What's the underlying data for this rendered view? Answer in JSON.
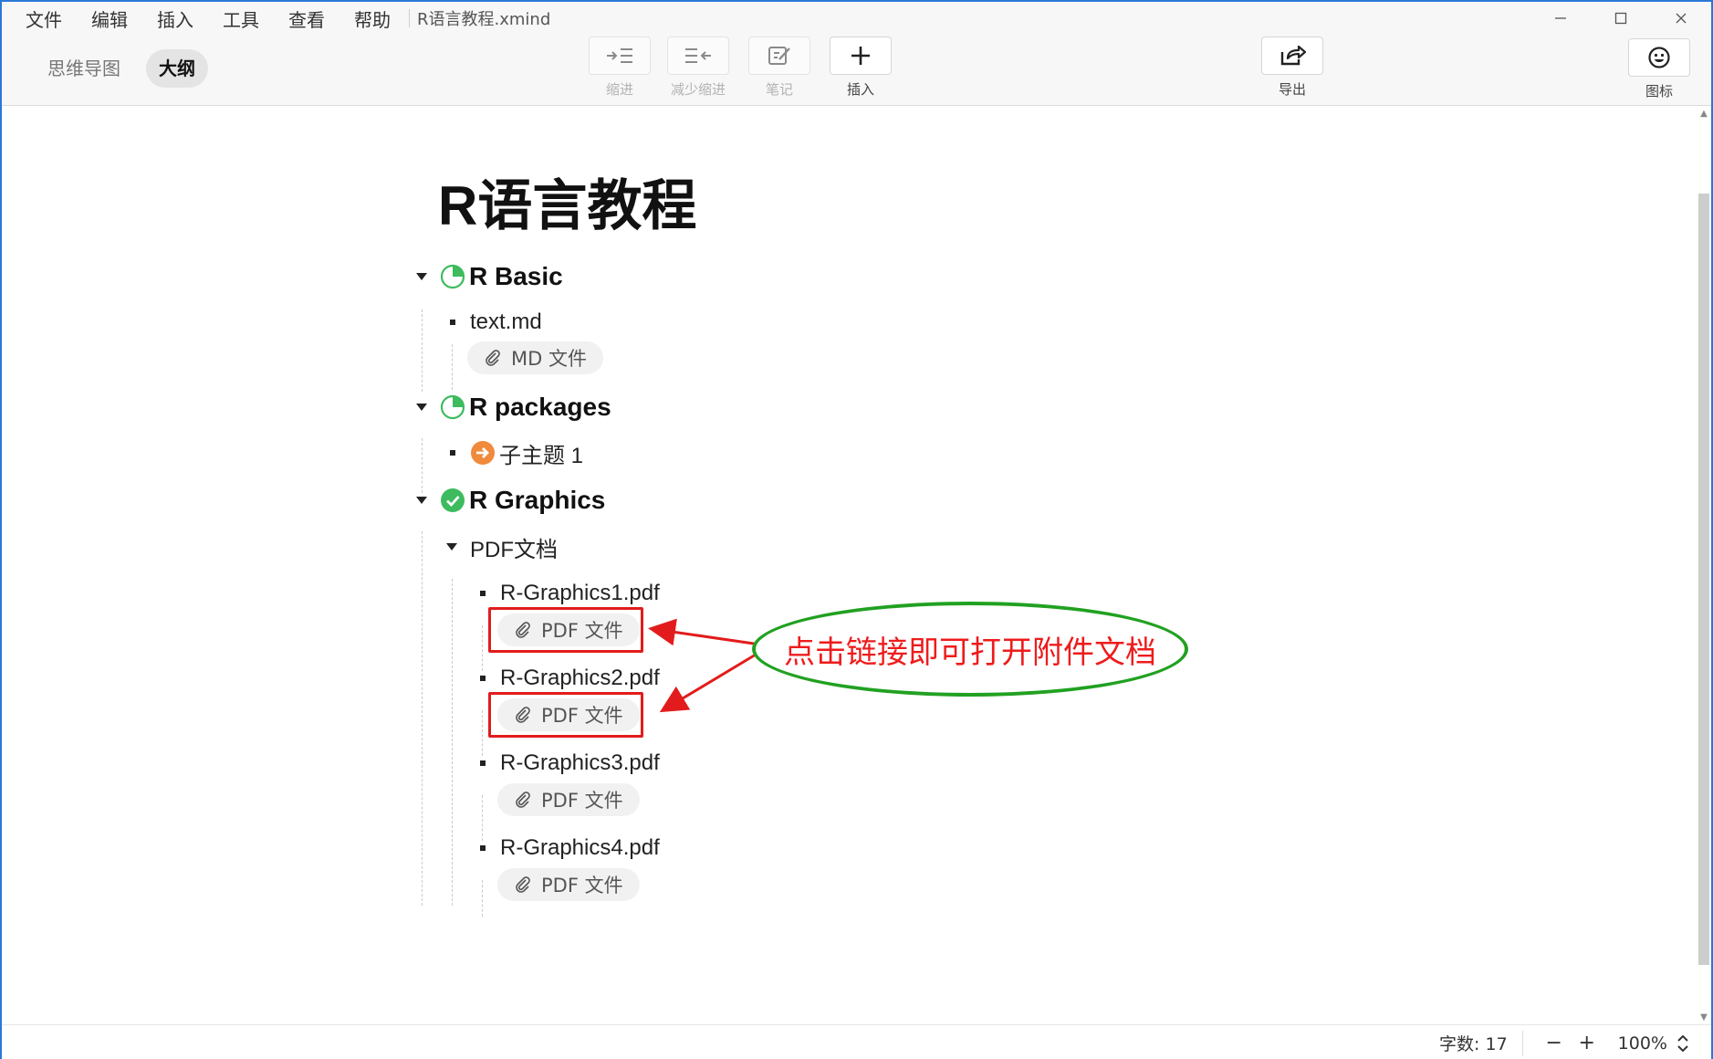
{
  "menubar": {
    "items": [
      "文件",
      "编辑",
      "插入",
      "工具",
      "查看",
      "帮助"
    ],
    "document_title": "R语言教程.xmind"
  },
  "window_controls": {
    "minimize": "—",
    "maximize": "☐",
    "close": "✕"
  },
  "toolbar": {
    "view_switch": {
      "mindmap": "思维导图",
      "outline": "大纲",
      "active": "大纲"
    },
    "indent_label": "缩进",
    "outdent_label": "减少缩进",
    "note_label": "笔记",
    "insert_label": "插入",
    "export_label": "导出",
    "icons_label": "图标"
  },
  "outline": {
    "title": "R语言教程",
    "topics": [
      {
        "label": "R Basic",
        "marker": "progress-quarter",
        "children": [
          {
            "label": "text.md",
            "attachment": "MD 文件"
          }
        ]
      },
      {
        "label": "R packages",
        "marker": "progress-quarter",
        "children": [
          {
            "label": "子主题 1",
            "marker": "arrow-right-orange"
          }
        ]
      },
      {
        "label": "R Graphics",
        "marker": "check-green",
        "children": [
          {
            "label": "PDF文档",
            "children": [
              {
                "label": "R-Graphics1.pdf",
                "attachment": "PDF 文件"
              },
              {
                "label": "R-Graphics2.pdf",
                "attachment": "PDF 文件"
              },
              {
                "label": "R-Graphics3.pdf",
                "attachment": "PDF 文件"
              },
              {
                "label": "R-Graphics4.pdf",
                "attachment": "PDF 文件"
              }
            ]
          }
        ]
      }
    ]
  },
  "annotation": {
    "callout_text": "点击链接即可打开附件文档",
    "box_color": "#e21c1c",
    "ellipse_color": "#21a121",
    "text_color": "#ee1c1c"
  },
  "statusbar": {
    "word_count": "字数: 17",
    "zoom_out": "−",
    "zoom_in": "+",
    "zoom_level": "100%"
  },
  "colors": {
    "accent_blue": "#2b78d6",
    "marker_green": "#3dbb5e",
    "marker_orange": "#f08a3c"
  }
}
